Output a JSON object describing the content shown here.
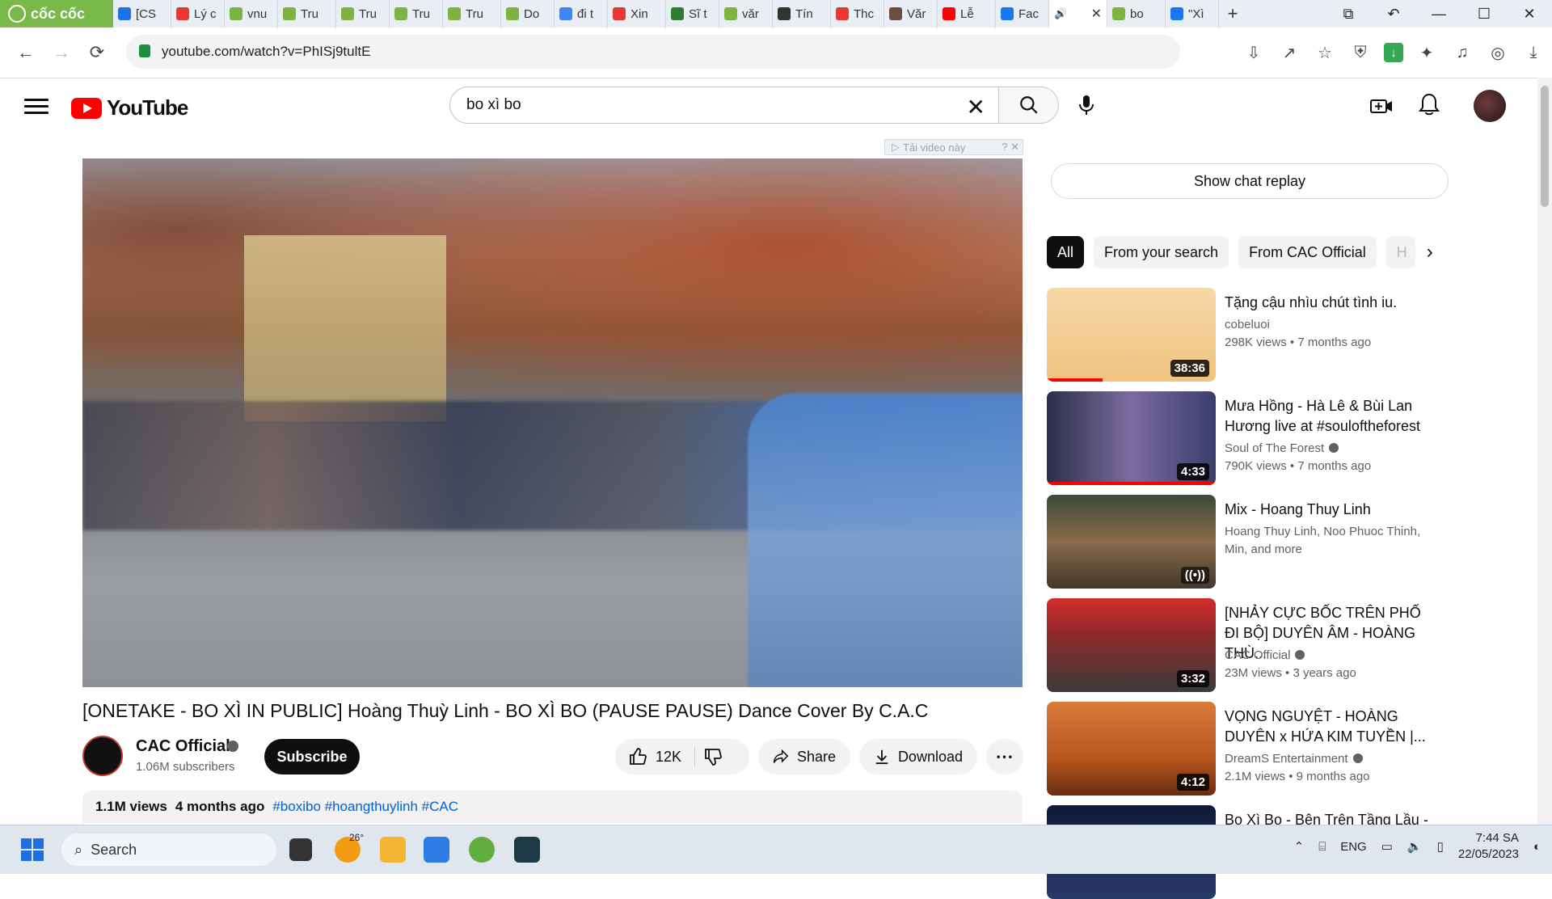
{
  "browser": {
    "brand": "cốc cốc",
    "tabs": [
      {
        "label": "[CS",
        "color": "#1a73e8"
      },
      {
        "label": "Lý c",
        "color": "#e53935"
      },
      {
        "label": "vnu",
        "color": "#7cb342"
      },
      {
        "label": "Tru",
        "color": "#7cb342"
      },
      {
        "label": "Tru",
        "color": "#7cb342"
      },
      {
        "label": "Tru",
        "color": "#7cb342"
      },
      {
        "label": "Tru",
        "color": "#7cb342"
      },
      {
        "label": "Do",
        "color": "#7cb342"
      },
      {
        "label": "đi t",
        "color": "#4285f4"
      },
      {
        "label": "Xin",
        "color": "#e53935"
      },
      {
        "label": "Sĩ t",
        "color": "#2e7d32"
      },
      {
        "label": "văr",
        "color": "#7cb342"
      },
      {
        "label": "Tín",
        "color": "#333333"
      },
      {
        "label": "Thc",
        "color": "#e53935"
      },
      {
        "label": "Văr",
        "color": "#6d4c41"
      },
      {
        "label": "Lễ",
        "color": "#ff0000"
      },
      {
        "label": "Fac",
        "color": "#1877f2"
      },
      {
        "label": "",
        "color": "#ffffff"
      },
      {
        "label": "bo",
        "color": "#7cb342"
      },
      {
        "label": "\"Xì",
        "color": "#1877f2"
      }
    ],
    "url": "youtube.com/watch?v=PhISj9tultE"
  },
  "youtube": {
    "search_query": "bo xì bo",
    "download_strip": "Tải video này",
    "video": {
      "title": "[ONETAKE - BO XÌ IN PUBLIC] Hoàng Thuỳ Linh - BO XÌ BO (PAUSE PAUSE) Dance Cover By C.A.C",
      "channel": "CAC Official",
      "subscribers": "1.06M subscribers",
      "subscribe_label": "Subscribe",
      "likes": "12K",
      "share_label": "Share",
      "download_label": "Download",
      "views": "1.1M views",
      "age": "4 months ago",
      "hashtags": "#boxibo #hoangthuylinh #CAC"
    },
    "sidebar": {
      "chat_replay": "Show chat replay",
      "chips": [
        "All",
        "From your search",
        "From CAC Official",
        "H"
      ],
      "recommendations": [
        {
          "title": "Tặng cậu nhìu chút tình iu.",
          "channel": "cobeluoi",
          "views": "298K views",
          "age": "7 months ago",
          "duration": "38:36",
          "verified": false,
          "progress": 0.33
        },
        {
          "title": "Mưa Hồng - Hà Lê & Bùi Lan Hương live at #souloftheforest",
          "channel": "Soul of The Forest",
          "views": "790K views",
          "age": "7 months ago",
          "duration": "4:33",
          "verified": true,
          "progress": 1.0
        },
        {
          "title": "Mix - Hoang Thuy Linh",
          "channel": "Hoang Thuy Linh, Noo Phuoc Thinh, Min, and more",
          "views": "",
          "age": "",
          "duration": "",
          "verified": false,
          "progress": 0
        },
        {
          "title": "[NHẢY CỰC BỐC TRÊN PHỐ ĐI BỘ] DUYÊN ÂM - HOÀNG THÙ...",
          "channel": "CAC Official",
          "views": "23M views",
          "age": "3 years ago",
          "duration": "3:32",
          "verified": true,
          "progress": 0
        },
        {
          "title": "VỌNG NGUYỆT - HOÀNG DUYÊN x HỨA KIM TUYỀN |...",
          "channel": "DreamS Entertainment",
          "views": "2.1M views",
          "age": "9 months ago",
          "duration": "4:12",
          "verified": true,
          "progress": 0
        },
        {
          "title": "Bo Xì Bo - Bên Trên Tầng Lầu -",
          "channel": "",
          "views": "",
          "age": "",
          "duration": "",
          "verified": false,
          "progress": 0
        }
      ]
    }
  },
  "taskbar": {
    "search_label": "Search",
    "temperature": "26°",
    "language": "ENG",
    "time": "7:44 SA",
    "date": "22/05/2023"
  }
}
